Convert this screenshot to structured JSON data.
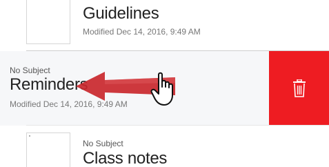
{
  "notes": [
    {
      "title": "Guidelines",
      "modified": "Modified Dec 14, 2016, 9:49 AM"
    },
    {
      "subject": "No Subject",
      "title": "Reminders",
      "modified": "Modified Dec 14, 2016, 9:49 AM",
      "swiped": true,
      "delete_action": {
        "icon": "trash-icon",
        "color": "#ee1c22"
      }
    },
    {
      "subject": "No Subject",
      "title": "Class notes"
    }
  ],
  "gesture": {
    "arrow_icon": "left-arrow-icon",
    "arrow_color": "#c9272c",
    "cursor_icon": "hand-pointer-icon"
  }
}
